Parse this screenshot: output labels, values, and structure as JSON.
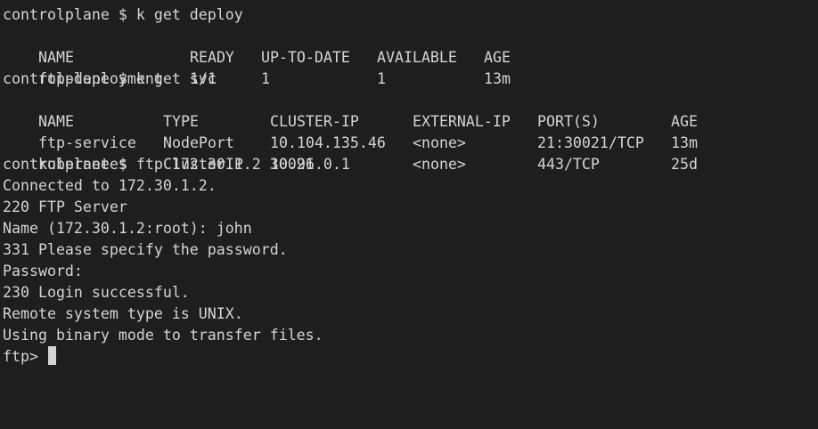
{
  "terminal": {
    "colors": {
      "background": "#1e1e1e",
      "foreground": "#d4d4d4"
    },
    "cmd_deploy": "controlplane $ k get deploy",
    "deploy_table": {
      "headers": [
        "NAME",
        "READY",
        "UP-TO-DATE",
        "AVAILABLE",
        "AGE"
      ],
      "rows": [
        [
          "ftp-deployment",
          "1/1",
          "1",
          "1",
          "13m"
        ]
      ]
    },
    "cmd_svc": "controlplane $ k get svc",
    "svc_table": {
      "headers": [
        "NAME",
        "TYPE",
        "CLUSTER-IP",
        "EXTERNAL-IP",
        "PORT(S)",
        "AGE"
      ],
      "rows": [
        [
          "ftp-service",
          "NodePort",
          "10.104.135.46",
          "<none>",
          "21:30021/TCP",
          "13m"
        ],
        [
          "kubernetes",
          "ClusterIP",
          "10.96.0.1",
          "<none>",
          "443/TCP",
          "25d"
        ]
      ]
    },
    "cmd_ftp": "controlplane $ ftp 172.30.1.2 30021",
    "output": [
      "Connected to 172.30.1.2.",
      "220 FTP Server",
      "Name (172.30.1.2:root): john",
      "331 Please specify the password.",
      "Password:",
      "230 Login successful.",
      "Remote system type is UNIX.",
      "Using binary mode to transfer files."
    ],
    "prompt": "ftp> "
  }
}
